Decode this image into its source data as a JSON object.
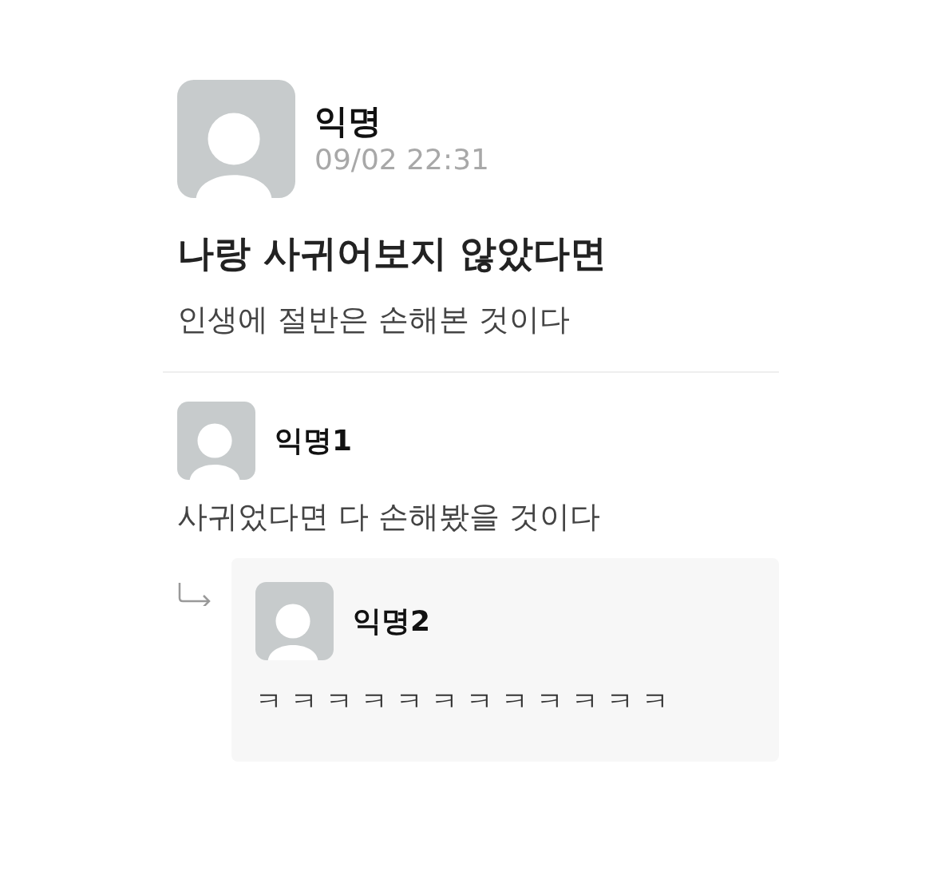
{
  "post": {
    "author": "익명",
    "time": "09/02 22:31",
    "title": "나랑 사귀어보지 않았다면",
    "body": "인생에 절반은 손해본 것이다"
  },
  "comments": [
    {
      "author": "익명1",
      "text": "사귀었다면 다 손해봤을 것이다",
      "children": [
        {
          "author": "익명2",
          "text": "ㅋㅋㅋㅋㅋㅋㅋㅋㅋㅋㅋㅋ"
        }
      ]
    }
  ]
}
